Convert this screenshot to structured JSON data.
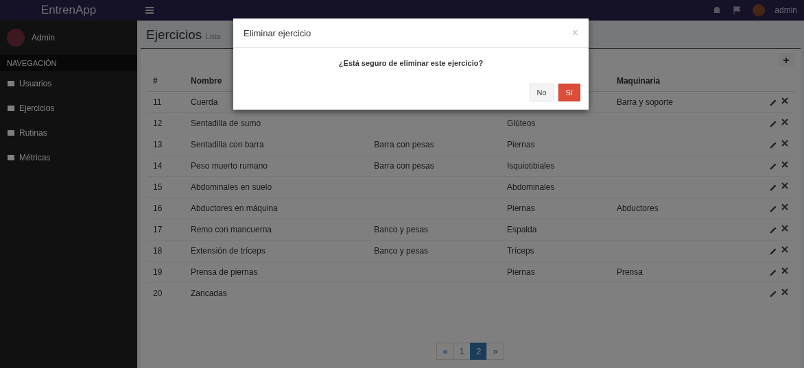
{
  "topbar": {
    "brand": "EntrenApp",
    "user": "admin"
  },
  "sidebar": {
    "user": "Admin",
    "section": "NAVEGACIÓN",
    "items": [
      "Usuarios",
      "Ejercicios",
      "Rutinas",
      "Métricas"
    ]
  },
  "page": {
    "title": "Ejercicios",
    "subtitle": "Lista"
  },
  "table": {
    "header": {
      "number": "#",
      "name": "Nombre",
      "column_5": "Maquinaria"
    },
    "rows": [
      [
        "11",
        "Cuerda",
        "",
        "",
        "Barra y soporte"
      ],
      [
        "12",
        "Sentadilla de sumo",
        "",
        "Glúteos",
        ""
      ],
      [
        "13",
        "Sentadilla con barra",
        "Barra con pesas",
        "Piernas",
        ""
      ],
      [
        "14",
        "Peso muerto rumano",
        "Barra con pesas",
        "Isquiotibiales",
        ""
      ],
      [
        "15",
        "Abdominales en suelo",
        "",
        "Abdominales",
        ""
      ],
      [
        "16",
        "Abductores en máquina",
        "",
        "Piernas",
        "Abductores"
      ],
      [
        "17",
        "Remo con mancuerna",
        "Banco y pesas",
        "Espalda",
        ""
      ],
      [
        "18",
        "Extensión de tríceps",
        "Banco y pesas",
        "Tríceps",
        ""
      ],
      [
        "19",
        "Prensa de piernas",
        "",
        "Piernas",
        "Prensa"
      ],
      [
        "20",
        "Zancadas",
        "",
        "",
        ""
      ]
    ]
  },
  "pagination": [
    {
      "label": "«",
      "selected": false
    },
    {
      "label": "1",
      "selected": false
    },
    {
      "label": "2",
      "selected": true
    },
    {
      "label": "»",
      "selected": false
    }
  ],
  "modal": {
    "title": "Eliminar ejercicio",
    "message": "¿Está seguro de eliminar este ejercicio?",
    "close": "×",
    "buttons": [
      {
        "label": "No",
        "kind": "default"
      },
      {
        "label": "Sí",
        "kind": "danger"
      }
    ]
  }
}
